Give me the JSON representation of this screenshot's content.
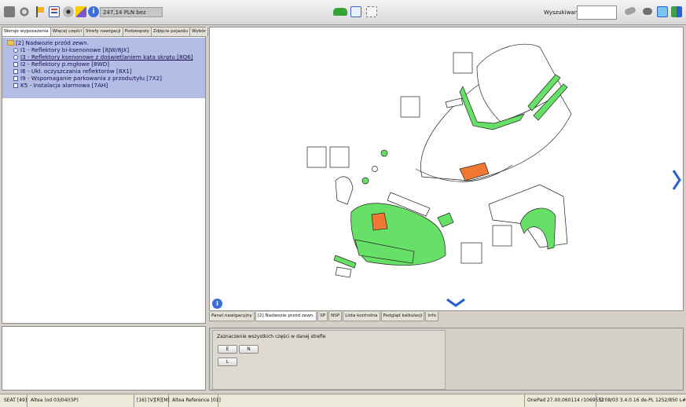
{
  "toolbar": {
    "icons": [
      "save-icon",
      "settings-icon",
      "flag-icon",
      "checklist-icon",
      "eye-icon",
      "highlighter-icon",
      "info-icon"
    ],
    "price": "247,14 PLN bez",
    "center_icons": [
      "car-icon",
      "zoom-icon",
      "fit-icon"
    ],
    "search_label": "Wyszukiwanie:",
    "search_value": "",
    "right_icons": [
      "eraser-icon",
      "brush-icon",
      "window-icon",
      "export-icon"
    ]
  },
  "left_tabs": [
    "Wersje wyposażenia",
    "Więcej części",
    "Strefy nawigacji",
    "Podzespoły",
    "Zdjęcia pojazdu",
    "Wybór"
  ],
  "tree": {
    "root": "[2] Nadwozie przód zewn.",
    "items": [
      {
        "kind": "radio",
        "label": "I1 - Reflektory bi-ksenonowe [8JW/8JX]"
      },
      {
        "kind": "radio",
        "label": "I3 - Reflektory ksenonowe z doświetlaniem kąta skrętu [8Q6]"
      },
      {
        "kind": "check",
        "label": "I2 - Reflektory p.mgłowe [8WD]"
      },
      {
        "kind": "check",
        "label": "I6 - Ukł. oczyszczania reflektorów [8X1]"
      },
      {
        "kind": "check",
        "label": "I9 - Wspomaganie parkowania z przodu/tyłu [7X2]"
      },
      {
        "kind": "check",
        "label": "K5 - Instalacja alarmowa [7AH]"
      }
    ]
  },
  "bottom_tabs": [
    "Panel nawigacyjny",
    "[2] Nadwozie przód zewn.",
    "SP",
    "NSP",
    "Lista kontrolna",
    "Podgląd kalkulacji",
    "Info"
  ],
  "zone": {
    "label": "Zaznaczenie wszystkich części w danej strefie",
    "buttons": [
      "E",
      "N",
      "L"
    ]
  },
  "status": {
    "left": [
      "SEAT [49]",
      "Altea (od 03/04)(5P)",
      "[16]  [V][R][M]",
      "Altea Reference [01]"
    ],
    "right": [
      "OnePad 27.00.060114 r1069552",
      "D  08/03 3.4.0.16 de-PL 1252/850 L#:1"
    ]
  },
  "colors": {
    "part_green": "#66e066",
    "part_orange": "#f07832",
    "selection": "#b6bde4",
    "accent_blue": "#2a5fd4"
  }
}
